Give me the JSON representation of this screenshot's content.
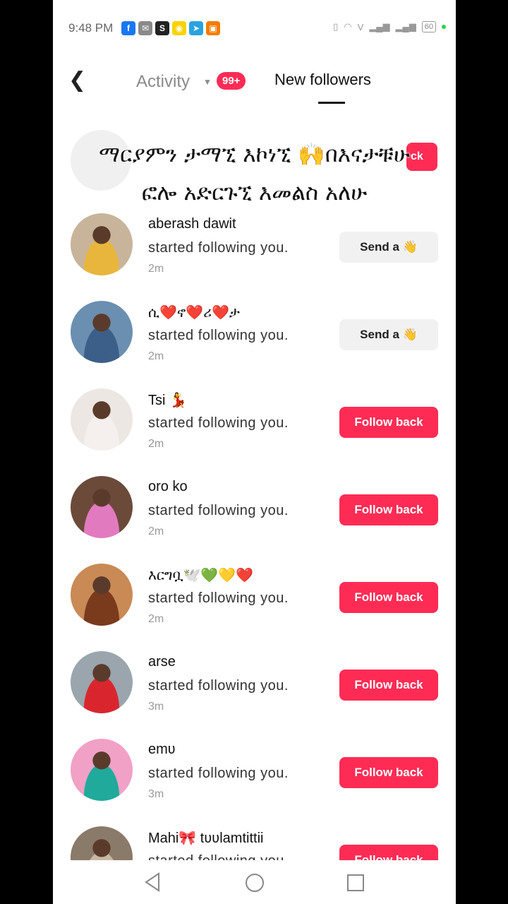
{
  "status": {
    "time": "9:48 PM",
    "battery": "60",
    "notif_icons": [
      {
        "name": "facebook-icon",
        "glyph": "f",
        "color": "#1877f2"
      },
      {
        "name": "messenger-icon",
        "glyph": "✉",
        "color": "#8a8a8a"
      },
      {
        "name": "skype-icon",
        "glyph": "S",
        "color": "#222222"
      },
      {
        "name": "snapchat-icon",
        "glyph": "◉",
        "color": "#f7d300"
      },
      {
        "name": "telegram-icon",
        "glyph": "➤",
        "color": "#2aa3df"
      },
      {
        "name": "app-icon",
        "glyph": "▣",
        "color": "#f57c00"
      }
    ]
  },
  "header": {
    "activity_label": "Activity",
    "badge": "99+",
    "new_followers_label": "New followers"
  },
  "overlay": {
    "line1": "ማርያምን ታማኚ እኮነኚ 🙌በእናታቹሁ",
    "line2": "ፎሎ አድርጉኚ እመልስ አለሁ",
    "hidden_button_fragment": "ck"
  },
  "followers": [
    {
      "name": "aberash dawit",
      "message": "started following you.",
      "time": "2m",
      "button": "Send a 👋",
      "type": "send",
      "avatar_color": "#c8b49a",
      "shirt": "#e8b63c"
    },
    {
      "name": "ሲ❤️ኖ❤️ሪ❤️ታ",
      "message": "started following you.",
      "time": "2m",
      "button": "Send a 👋",
      "type": "send",
      "avatar_color": "#6a8fb0",
      "shirt": "#3c5f8a"
    },
    {
      "name": "Tsi 💃",
      "message": "started following you.",
      "time": "2m",
      "button": "Follow back",
      "type": "follow",
      "avatar_color": "#ede7e3",
      "shirt": "#f5f0ee"
    },
    {
      "name": "oro ko",
      "message": "started following you.",
      "time": "2m",
      "button": "Follow back",
      "type": "follow",
      "avatar_color": "#6b4a3a",
      "shirt": "#e27ac0"
    },
    {
      "name": "እርግቧ🕊️💚💛❤️",
      "message": "started following you.",
      "time": "2m",
      "button": "Follow back",
      "type": "follow",
      "avatar_color": "#c98a55",
      "shirt": "#7a3a1c"
    },
    {
      "name": "arse",
      "message": "started following you.",
      "time": "3m",
      "button": "Follow back",
      "type": "follow",
      "avatar_color": "#9aa5ad",
      "shirt": "#d9262e"
    },
    {
      "name": "emʋ",
      "message": "started following you.",
      "time": "3m",
      "button": "Follow back",
      "type": "follow",
      "avatar_color": "#f2a1c6",
      "shirt": "#1faa9c"
    },
    {
      "name": "Mahi🎀 tʋʋlamtittii",
      "message": "started following you.",
      "time": "",
      "button": "Follow back",
      "type": "follow",
      "avatar_color": "#8a7a6a",
      "shirt": "#c7b8a5"
    }
  ]
}
